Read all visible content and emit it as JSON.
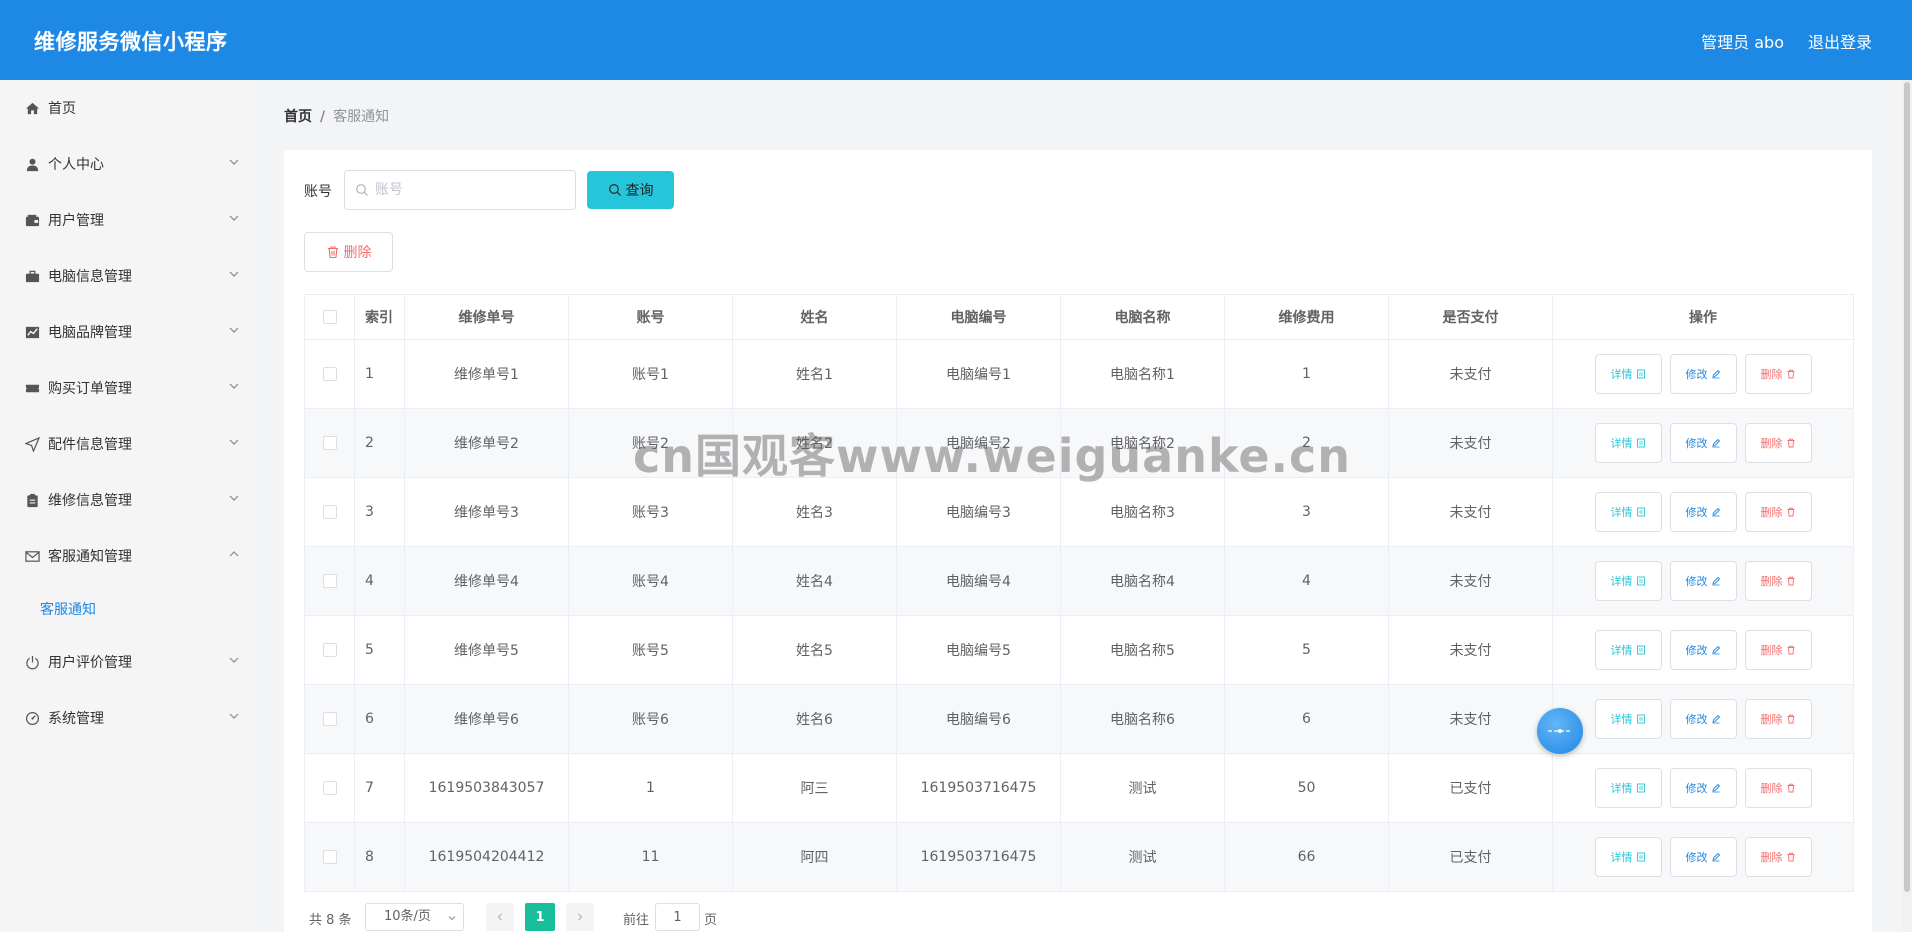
{
  "header": {
    "app_title": "维修服务微信小程序",
    "user": "管理员 abo",
    "logout": "退出登录"
  },
  "sidebar": {
    "items": [
      {
        "label": "首页",
        "icon": "home-icon"
      },
      {
        "label": "个人中心",
        "icon": "user-icon"
      },
      {
        "label": "用户管理",
        "icon": "wallet-icon"
      },
      {
        "label": "电脑信息管理",
        "icon": "briefcase-icon"
      },
      {
        "label": "电脑品牌管理",
        "icon": "chart-icon"
      },
      {
        "label": "购买订单管理",
        "icon": "ticket-icon"
      },
      {
        "label": "配件信息管理",
        "icon": "send-icon"
      },
      {
        "label": "维修信息管理",
        "icon": "clipboard-icon"
      },
      {
        "label": "客服通知管理",
        "icon": "mail-icon"
      },
      {
        "label": "用户评价管理",
        "icon": "power-icon"
      },
      {
        "label": "系统管理",
        "icon": "dashboard-icon"
      }
    ],
    "sub_item": "客服通知"
  },
  "breadcrumb": {
    "home": "首页",
    "separator": "/",
    "current": "客服通知"
  },
  "search": {
    "label": "账号",
    "placeholder": "账号",
    "button": "查询"
  },
  "actions": {
    "delete": "删除"
  },
  "table": {
    "columns": [
      "索引",
      "维修单号",
      "账号",
      "姓名",
      "电脑编号",
      "电脑名称",
      "维修费用",
      "是否支付",
      "操作"
    ],
    "rows": [
      [
        "1",
        "维修单号1",
        "账号1",
        "姓名1",
        "电脑编号1",
        "电脑名称1",
        "1",
        "未支付"
      ],
      [
        "2",
        "维修单号2",
        "账号2",
        "姓名2",
        "电脑编号2",
        "电脑名称2",
        "2",
        "未支付"
      ],
      [
        "3",
        "维修单号3",
        "账号3",
        "姓名3",
        "电脑编号3",
        "电脑名称3",
        "3",
        "未支付"
      ],
      [
        "4",
        "维修单号4",
        "账号4",
        "姓名4",
        "电脑编号4",
        "电脑名称4",
        "4",
        "未支付"
      ],
      [
        "5",
        "维修单号5",
        "账号5",
        "姓名5",
        "电脑编号5",
        "电脑名称5",
        "5",
        "未支付"
      ],
      [
        "6",
        "维修单号6",
        "账号6",
        "姓名6",
        "电脑编号6",
        "电脑名称6",
        "6",
        "未支付"
      ],
      [
        "7",
        "1619503843057",
        "1",
        "阿三",
        "1619503716475",
        "测试",
        "50",
        "已支付"
      ],
      [
        "8",
        "1619504204412",
        "11",
        "阿四",
        "1619503716475",
        "测试",
        "66",
        "已支付"
      ]
    ],
    "row_actions": {
      "detail": "详情",
      "edit": "修改",
      "delete": "删除"
    }
  },
  "watermark": "cn国观客www.weiguanke.cn",
  "pagination": {
    "total": "共 8 条",
    "page_size": "10条/页",
    "current_page": "1",
    "goto_label": "前往",
    "goto_value": "1",
    "page_unit": "页"
  },
  "colors": {
    "header": "#1e88e5",
    "query_button": "#26c6da",
    "active_page": "#19be9b",
    "danger": "#f56c6c"
  }
}
